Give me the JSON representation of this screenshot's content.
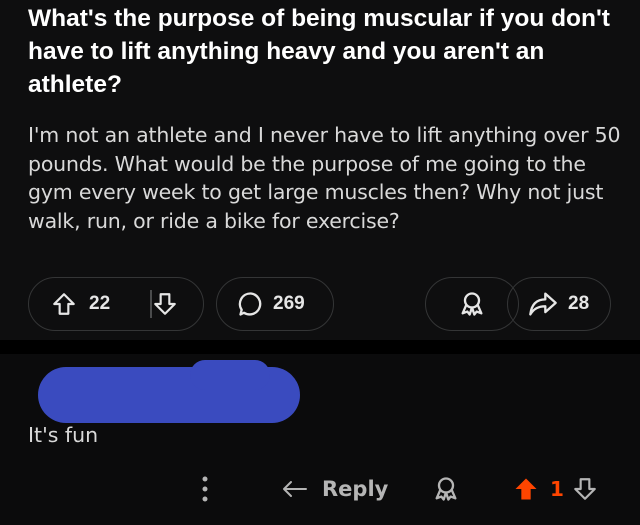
{
  "post": {
    "title": "What's the purpose of being muscular if you don't have to lift anything heavy and you aren't an athlete?",
    "body": "I'm not an athlete and I never have to lift anything over 50 pounds. What would be the purpose of me going to the gym every week to get large muscles then? Why not just walk, run, or ride a bike for exercise?",
    "vote_count": "22",
    "comment_count": "269",
    "share_count": "28"
  },
  "comment": {
    "text": "It's fun",
    "reply_label": "Reply",
    "score": "1"
  },
  "colors": {
    "background": "#0b0b0c",
    "upvoted": "#ff4500",
    "redaction": "#3a4bbf"
  }
}
